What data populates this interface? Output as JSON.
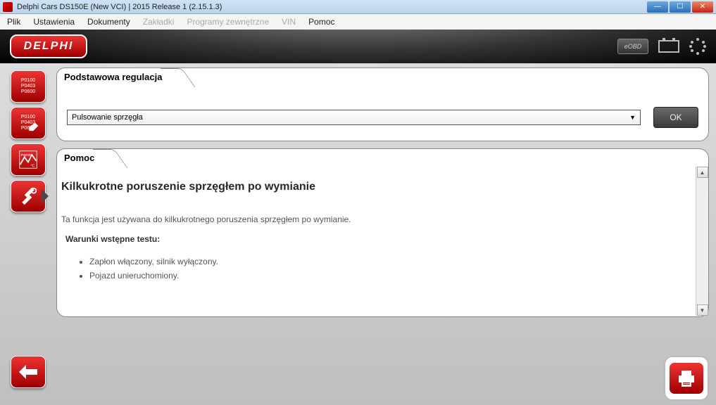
{
  "window": {
    "title": "Delphi Cars DS150E (New VCI) | 2015 Release 1 (2.15.1.3)"
  },
  "menu": {
    "plik": "Plik",
    "ustawienia": "Ustawienia",
    "dokumenty": "Dokumenty",
    "zakladki": "Zakładki",
    "programy": "Programy zewnętrzne",
    "vin": "VIN",
    "pomoc": "Pomoc"
  },
  "brand": {
    "logo": "DELPHI",
    "eobd": "eOBD"
  },
  "sidebar": {
    "codes1": "P0100\nP0403\nP0600",
    "codes2": "P0100\nP0403\nP060"
  },
  "regulation": {
    "title": "Podstawowa regulacja",
    "dropdown_value": "Pulsowanie sprzęgła",
    "ok": "OK"
  },
  "help": {
    "title": "Pomoc",
    "heading": "Kilkukrotne poruszenie sprzęgłem po wymianie",
    "desc": "Ta funkcja jest używana do kilkukrotnego poruszenia sprzęgłem po wymianie.",
    "pre_title": "Warunki wstępne testu:",
    "bullet1": "Zapłon włączony, silnik wyłączony.",
    "bullet2": "Pojazd unieruchomiony."
  }
}
